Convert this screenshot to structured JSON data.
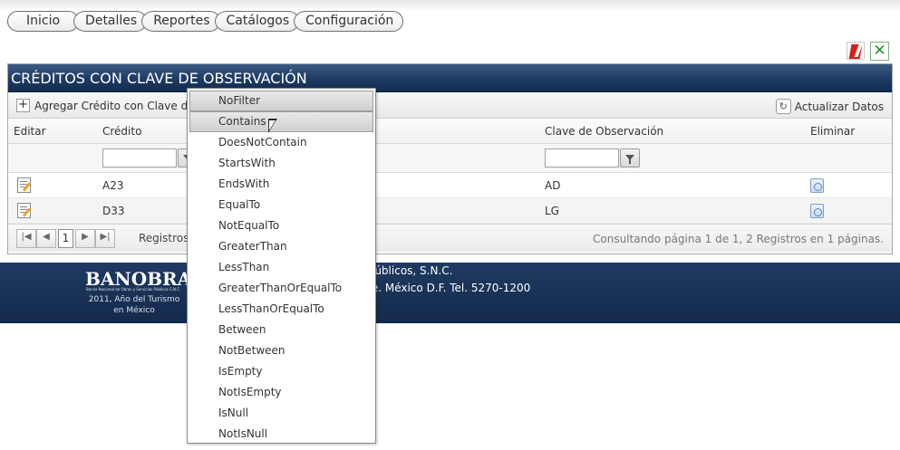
{
  "nav": {
    "items": [
      "Inicio",
      "Detalles",
      "Reportes",
      "Catálogos",
      "Configuración"
    ]
  },
  "toolbar_icons": {
    "export_pdf": "pdf-export-icon",
    "export_excel": "excel-export-icon"
  },
  "grid": {
    "title": "CRÉDITOS CON CLAVE DE OBSERVACIÓN",
    "add_label": "Agregar Crédito con Clave de O",
    "refresh_label": "Actualizar Datos",
    "columns": [
      "Editar",
      "Crédito",
      "Clave de Observación",
      "Eliminar"
    ],
    "rows": [
      {
        "credito": "A23",
        "clave": "AD"
      },
      {
        "credito": "D33",
        "clave": "LG"
      }
    ],
    "pager": {
      "current_page": "1",
      "label_partial": "Registros p",
      "summary": "Consultando página 1 de 1, 2 Registros en 1 páginas."
    }
  },
  "filter_menu": {
    "selected": "Contains",
    "options": [
      "NoFilter",
      "Contains",
      "DoesNotContain",
      "StartsWith",
      "EndsWith",
      "EqualTo",
      "NotEqualTo",
      "GreaterThan",
      "LessThan",
      "GreaterThanOrEqualTo",
      "LessThanOrEqualTo",
      "Between",
      "NotBetween",
      "IsEmpty",
      "NotIsEmpty",
      "IsNull",
      "NotIsNull"
    ]
  },
  "footer": {
    "logo": "BANOBRAS",
    "logo_tagline": "Banco Nacional de Obras y Servicios Públicos S.N.C.",
    "year_line1": "2011, Año del Turismo",
    "year_line2": "en México",
    "line1": "onal de Obras y Servicios Públicos, S.N.C.",
    "line2": "515 Col. Lomas de Santa Fe. México D.F. Tel. 5270-1200"
  },
  "colors": {
    "header_blue": "#1d3a63",
    "footer_blue": "#132a4b"
  }
}
